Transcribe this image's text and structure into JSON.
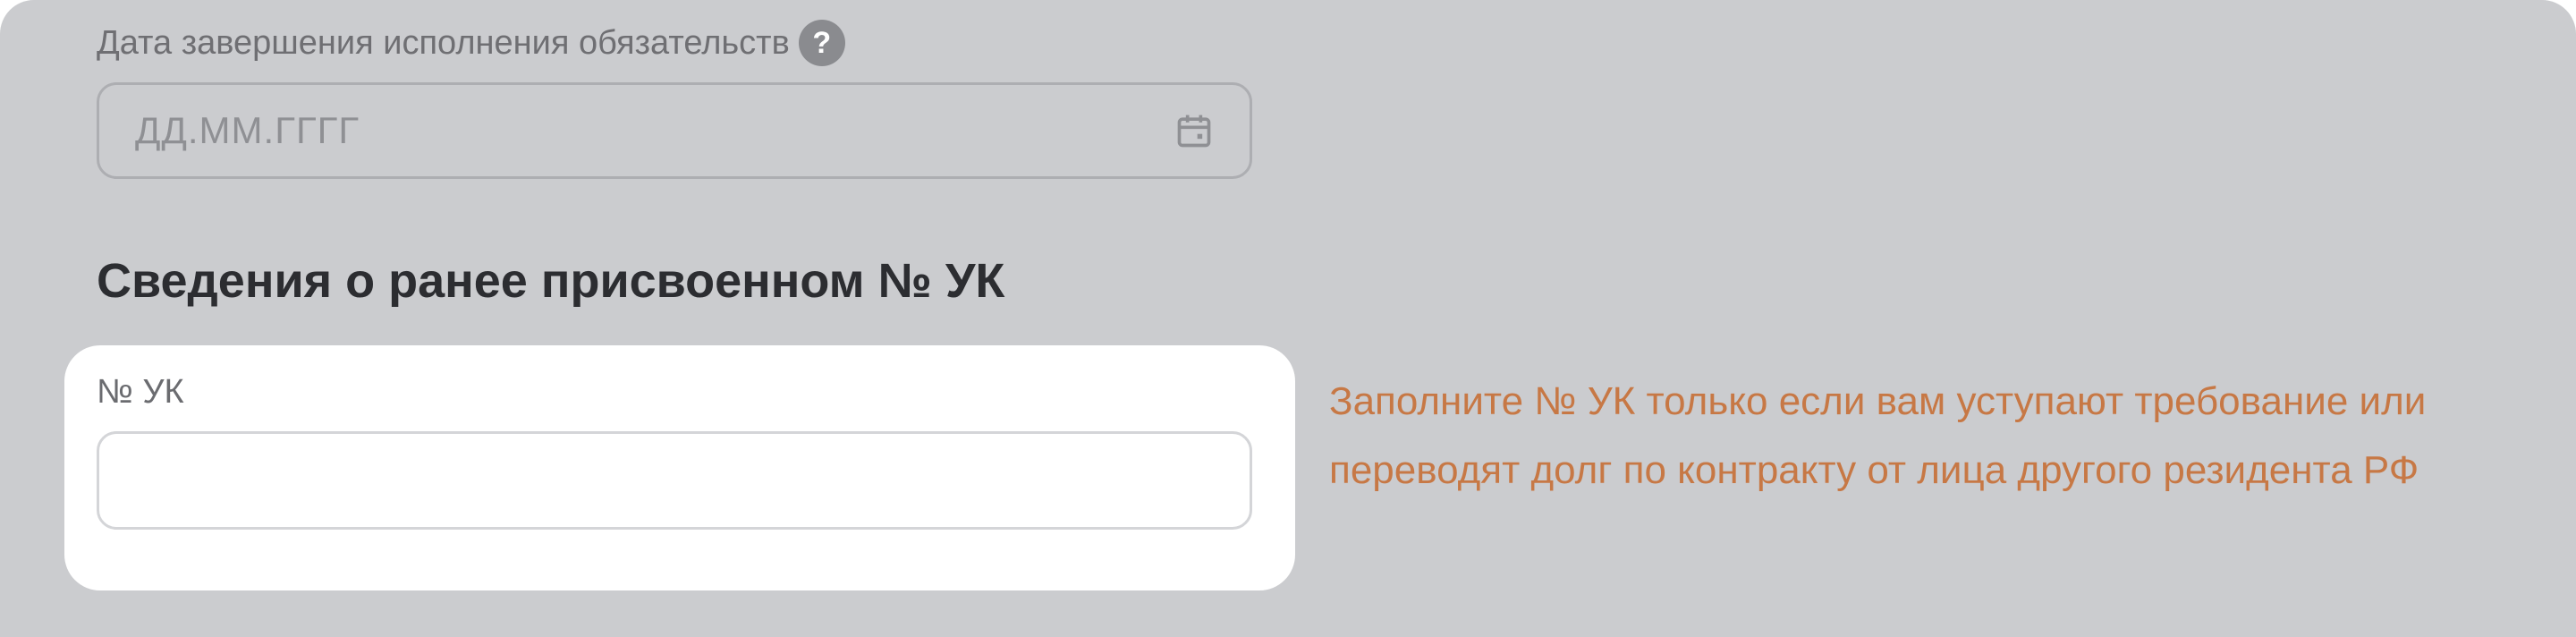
{
  "date_section": {
    "label": "Дата завершения исполнения обязательств",
    "help_icon": "question-mark-icon",
    "input": {
      "placeholder": "ДД.ММ.ГГГГ",
      "value": "",
      "icon": "calendar-icon"
    }
  },
  "uk_section": {
    "title": "Сведения о ранее присвоенном № УК",
    "field_label": "№ УК",
    "input": {
      "value": "",
      "placeholder": ""
    },
    "hint": "Заполните № УК только если вам уступают требование или переводят долг по контракту от лица другого резидента РФ"
  },
  "colors": {
    "panel_background": "#cbcccf",
    "card_background": "#ffffff",
    "hint_text": "#c77845",
    "title_text": "#2c2d31",
    "help_icon_bg": "#8a8b8f"
  }
}
